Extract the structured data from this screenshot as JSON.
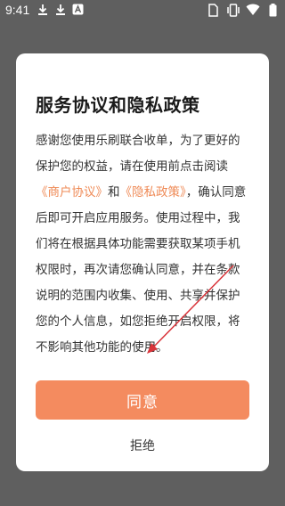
{
  "status_bar": {
    "time": "9:41",
    "icons": [
      "download-icon",
      "download-icon",
      "app-notification-icon",
      "sim-card-icon",
      "vibrate-icon",
      "wifi-icon",
      "battery-icon"
    ]
  },
  "dialog": {
    "title": "服务协议和隐私政策",
    "body_part1": "感谢您使用乐刷联合收单，为了更好的保护您的权益，请在使用前点击阅读",
    "link_merchant_agreement": "《商户协议》",
    "body_and": "和",
    "link_privacy_policy": "《隐私政策》",
    "body_part2": "，确认同意后即可开启应用服务。使用过程中，我们将在根据具体功能需要获取某项手机权限时，再次请您确认同意，并在条款说明的范围内收集、使用、共享并保护您的个人信息，如您拒绝开启权限，将不影响其他功能的使用。",
    "agree_label": "同意",
    "reject_label": "拒绝"
  },
  "colors": {
    "overlay": "#5f5f5f",
    "accent": "#f48b5f",
    "link": "#ef8a56",
    "annotation_arrow": "#d9343a"
  }
}
